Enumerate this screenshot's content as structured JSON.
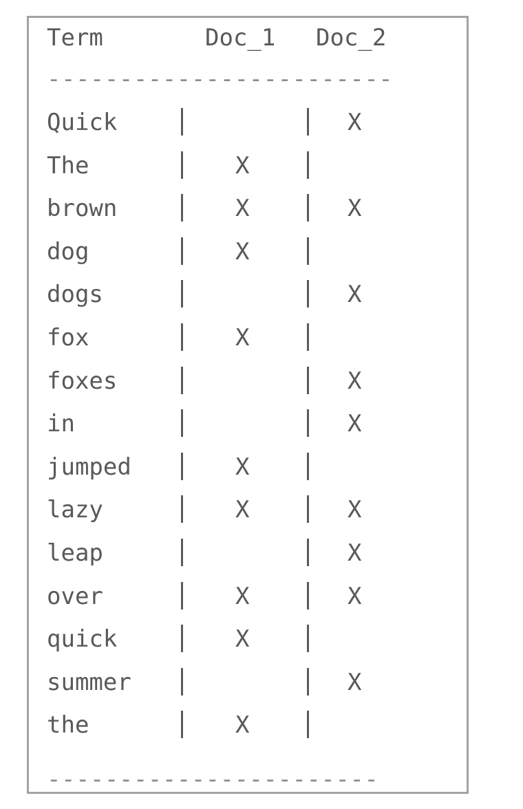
{
  "header": {
    "term": "Term",
    "doc1": "Doc_1",
    "doc2": "Doc_2"
  },
  "rule_top": "------------------------",
  "rule_bottom": "-----------------------",
  "rows": [
    {
      "term": "Quick",
      "doc1": "",
      "doc2": "X"
    },
    {
      "term": "The",
      "doc1": "X",
      "doc2": ""
    },
    {
      "term": "brown",
      "doc1": "X",
      "doc2": "X"
    },
    {
      "term": "dog",
      "doc1": "X",
      "doc2": ""
    },
    {
      "term": "dogs",
      "doc1": "",
      "doc2": "X"
    },
    {
      "term": "fox",
      "doc1": "X",
      "doc2": ""
    },
    {
      "term": "foxes",
      "doc1": "",
      "doc2": "X"
    },
    {
      "term": "in",
      "doc1": "",
      "doc2": "X"
    },
    {
      "term": "jumped",
      "doc1": "X",
      "doc2": ""
    },
    {
      "term": "lazy",
      "doc1": "X",
      "doc2": "X"
    },
    {
      "term": "leap",
      "doc1": "",
      "doc2": "X"
    },
    {
      "term": "over",
      "doc1": "X",
      "doc2": "X"
    },
    {
      "term": "quick",
      "doc1": "X",
      "doc2": ""
    },
    {
      "term": "summer",
      "doc1": "",
      "doc2": "X"
    },
    {
      "term": "the",
      "doc1": "X",
      "doc2": ""
    }
  ]
}
